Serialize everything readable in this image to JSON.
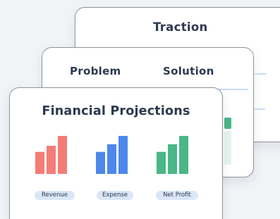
{
  "cards": {
    "traction": {
      "title": "Traction"
    },
    "problem_solution": {
      "problem_title": "Problem",
      "solution_title": "Solution"
    },
    "financial": {
      "title": "Financial Projections",
      "labels": {
        "revenue": "Revenue",
        "expense": "Expense",
        "net_profit": "Net Profit"
      }
    }
  },
  "colors": {
    "background": "#f1f3f7",
    "card_border": "#8e949c",
    "title_text": "#2c3a4f",
    "pill_background": "#dbe7f8",
    "revenue": "#f47c76",
    "expense": "#4c88ec",
    "net_profit": "#49b787"
  },
  "chart_data": {
    "type": "bar",
    "title": "Financial Projections",
    "series": [
      {
        "name": "Revenue",
        "values": [
          0.58,
          0.74,
          1.0
        ],
        "color": "#f47c76"
      },
      {
        "name": "Expense",
        "values": [
          0.58,
          0.78,
          1.0
        ],
        "color": "#4c88ec"
      },
      {
        "name": "Net Profit",
        "values": [
          0.58,
          0.78,
          1.0
        ],
        "color": "#49b787"
      }
    ]
  }
}
